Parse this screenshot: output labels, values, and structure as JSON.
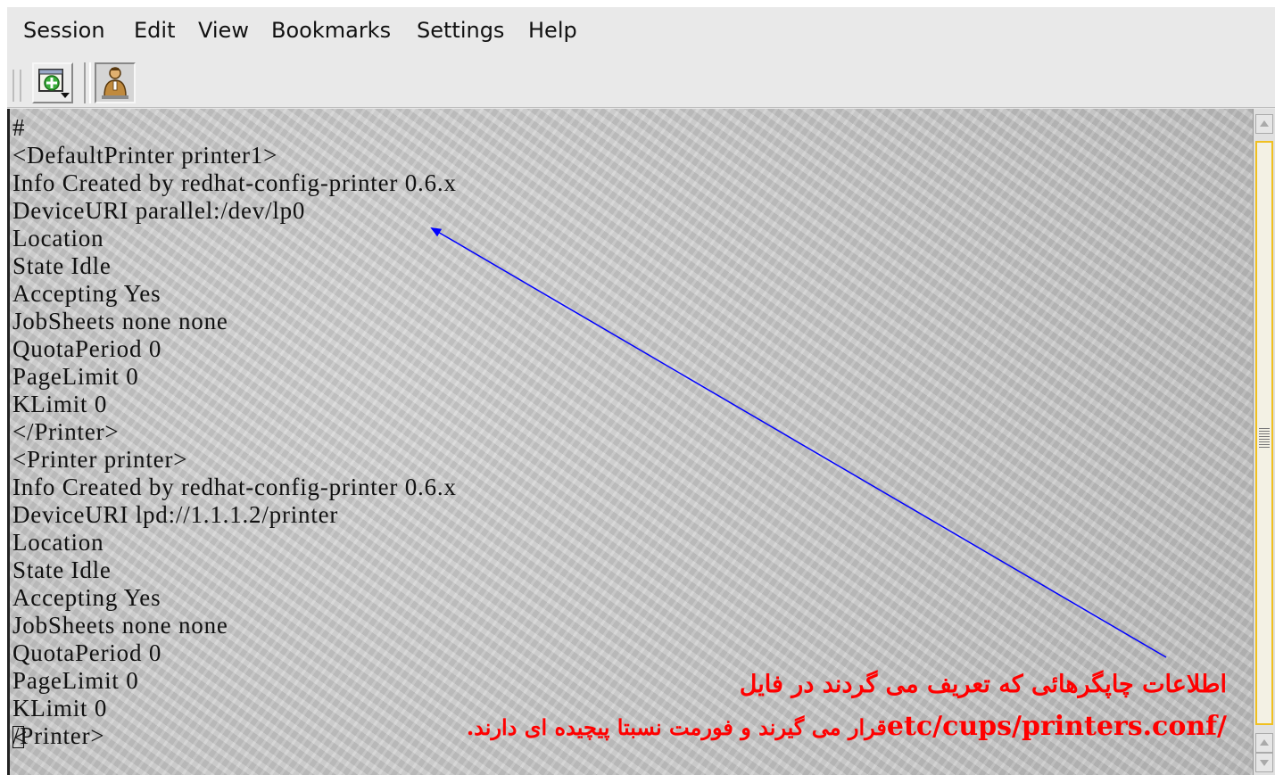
{
  "menubar": {
    "items": [
      {
        "label": "Session"
      },
      {
        "label": "Edit"
      },
      {
        "label": "View"
      },
      {
        "label": "Bookmarks"
      },
      {
        "label": "Settings"
      },
      {
        "label": "Help"
      }
    ]
  },
  "toolbar": {
    "buttons": [
      {
        "icon": "new-session-icon"
      },
      {
        "icon": "session-user-icon"
      }
    ]
  },
  "terminal": {
    "lines": [
      "#",
      "<DefaultPrinter printer1>",
      "Info Created by redhat-config-printer 0.6.x",
      "DeviceURI parallel:/dev/lp0",
      "Location",
      "State Idle",
      "Accepting Yes",
      "JobSheets none none",
      "QuotaPeriod 0",
      "PageLimit 0",
      "KLimit 0",
      "</Printer>",
      "<Printer printer>",
      "Info Created by redhat-config-printer 0.6.x",
      "DeviceURI lpd://1.1.1.2/printer",
      "Location",
      "State Idle",
      "Accepting Yes",
      "JobSheets none none",
      "QuotaPeriod 0",
      "PageLimit 0",
      "KLimit 0",
      "/Printer>"
    ],
    "cursor_char": "<"
  },
  "annotation": {
    "line1": "اطلاعات چاپگرهائی که تعریف می گردند در فایل",
    "line2_path": "etc/cups/printers.conf/",
    "line2_text": "قرار می گیرند و فورمت نسبتا پیچیده ای دارند.",
    "text_color": "#ff0000",
    "arrow_color": "#0000ff"
  },
  "colors": {
    "scrollbar_thumb_border": "#f0c020",
    "terminal_bg": "#c7c7c7"
  }
}
